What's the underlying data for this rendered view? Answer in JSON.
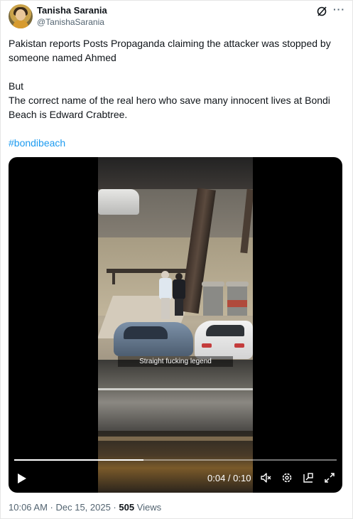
{
  "author": {
    "name": "Tanisha Sarania",
    "handle": "@TanishaSarania",
    "avatar_icon": "avatar-icon"
  },
  "header_icons": {
    "grok": "grok-icon",
    "more": "more-icon",
    "more_glyph": "···"
  },
  "post": {
    "paragraph1": "Pakistan reports Posts Propaganda  claiming the attacker was stopped by someone named Ahmed",
    "paragraph2_line1": "But",
    "paragraph2_line2": "The correct name of the real hero who save many innocent lives at Bondi Beach is Edward Crabtree.",
    "hashtag": "#bondibeach"
  },
  "video": {
    "caption": "Straight fucking legend",
    "time": "0:04 / 0:10",
    "progress": 0.4,
    "controls": [
      "play-icon",
      "volume-muted-icon",
      "settings-icon",
      "pip-icon",
      "fullscreen-icon"
    ]
  },
  "meta": {
    "timestamp": "10:06 AM · Dec 15, 2025 · ",
    "views_count": "505",
    "views_label": " Views"
  },
  "colors": {
    "link": "#1d9bf0",
    "secondary_text": "#536471",
    "primary_text": "#0f1419"
  }
}
